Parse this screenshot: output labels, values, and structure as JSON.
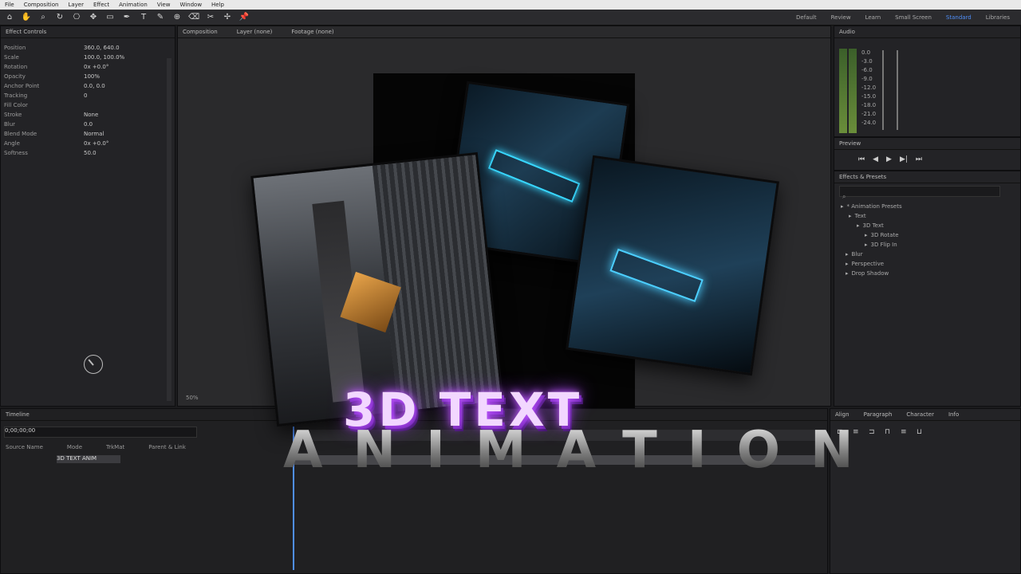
{
  "menu": [
    "File",
    "Composition",
    "Layer",
    "Effect",
    "Animation",
    "View",
    "Window",
    "Help"
  ],
  "toolbar": {
    "tools": [
      "home",
      "hand",
      "zoom",
      "rotate",
      "camera",
      "pan",
      "rect",
      "pen",
      "text",
      "brush",
      "stamp",
      "eraser",
      "roto",
      "puppet",
      "pin"
    ],
    "workspaces": [
      "Default",
      "Review",
      "Learn",
      "Small Screen",
      "Standard",
      "Libraries"
    ],
    "active_workspace": "Standard"
  },
  "effect_controls": {
    "tab": "Effect Controls",
    "props": [
      {
        "k": "Position",
        "v": "360.0, 640.0"
      },
      {
        "k": "Scale",
        "v": "100.0, 100.0%"
      },
      {
        "k": "Rotation",
        "v": "0x +0.0°"
      },
      {
        "k": "Opacity",
        "v": "100%"
      },
      {
        "k": "Anchor Point",
        "v": "0.0, 0.0"
      },
      {
        "k": "Tracking",
        "v": "0"
      },
      {
        "k": "Fill Color",
        "v": ""
      },
      {
        "k": "Stroke",
        "v": "None"
      },
      {
        "k": "Blur",
        "v": "0.0"
      },
      {
        "k": "Blend Mode",
        "v": "Normal"
      },
      {
        "k": "Angle",
        "v": "0x +0.0°"
      },
      {
        "k": "Softness",
        "v": "50.0"
      }
    ]
  },
  "composition": {
    "tab": "Composition",
    "sub_tabs": [
      "Layer (none)",
      "Footage (none)"
    ],
    "zoom": "50%"
  },
  "overlay": {
    "line1": "3D TEXT",
    "line2": "ANIMATION"
  },
  "audio": {
    "tab": "Audio",
    "db_values": [
      "0.0",
      "-3.0",
      "-6.0",
      "-9.0",
      "-12.0",
      "-15.0",
      "-18.0",
      "-21.0",
      "-24.0"
    ]
  },
  "preview": {
    "tab": "Preview"
  },
  "effects_presets": {
    "tab": "Effects & Presets",
    "tree": [
      "* Animation Presets",
      "Text",
      "3D Text",
      "3D Rotate",
      "3D Flip In",
      "Blur",
      "Perspective",
      "Drop Shadow"
    ]
  },
  "timeline": {
    "tab": "Timeline",
    "timecode": "0;00;00;00",
    "columns": [
      "Source Name",
      "Mode",
      "TrkMat",
      "Parent & Link"
    ],
    "layer_name": "3D TEXT ANIM"
  },
  "align_panel": {
    "tabs": [
      "Align",
      "Paragraph",
      "Character",
      "Info"
    ]
  },
  "colors": {
    "accent": "#4f8ef7",
    "glow": "#c35cff"
  }
}
